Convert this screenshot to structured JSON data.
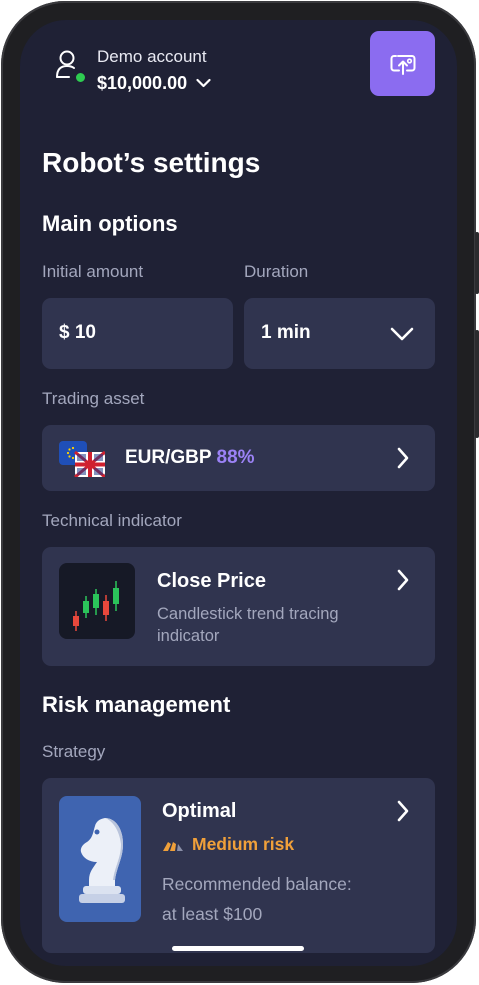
{
  "account": {
    "label": "Demo account",
    "balance": "$10,000.00"
  },
  "page_title": "Robot’s settings",
  "main_options": {
    "title": "Main options",
    "initial_amount": {
      "label": "Initial amount",
      "value": "$ 10"
    },
    "duration": {
      "label": "Duration",
      "value": "1 min"
    },
    "trading_asset": {
      "label": "Trading asset",
      "name": "EUR/GBP",
      "percent": "88%"
    },
    "technical_indicator": {
      "label": "Technical indicator",
      "name": "Close Price",
      "description": "Candlestick trend tracing indicator"
    }
  },
  "risk_management": {
    "title": "Risk management",
    "strategy": {
      "label": "Strategy",
      "name": "Optimal",
      "risk": "Medium risk",
      "recommendation_line1": "Recommended balance:",
      "recommendation_line2": "at least $100"
    }
  },
  "icons": {
    "user": "user-icon",
    "share": "share-icon",
    "dropdown": "chevron-down-icon",
    "navigate": "chevron-right-icon",
    "flags": "eu-uk-flag-icon",
    "candles": "candlestick-chart-icon",
    "strategy": "chess-knight-icon",
    "risk": "risk-gauge-icon"
  },
  "colors": {
    "background": "#1f2135",
    "card": "#30344f",
    "accent": "#8b6cf0",
    "percent": "#9b82f5",
    "risk": "#f0a03a",
    "online": "#2ecc51",
    "muted_text": "#a3a7bd",
    "strategy_tile": "#3f64b0"
  }
}
